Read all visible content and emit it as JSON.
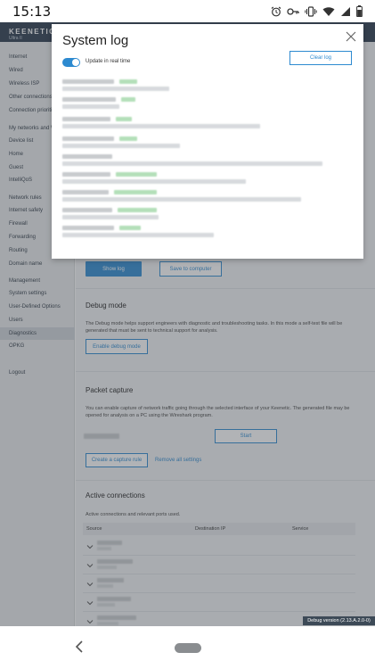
{
  "status_bar": {
    "time": "15:13",
    "icons": [
      "alarm-icon",
      "key-icon",
      "vibrate-icon",
      "wifi-icon",
      "signal-icon",
      "battery-icon"
    ]
  },
  "app": {
    "brand": "KEENETIC",
    "model": "Ultra II"
  },
  "sidebar": {
    "items": [
      {
        "label": "Internet"
      },
      {
        "label": "Wired"
      },
      {
        "label": "Wireless ISP"
      },
      {
        "label": "Other connections"
      },
      {
        "label": "Connection priorities"
      },
      {
        "label": "My networks and Wi-Fi"
      },
      {
        "label": "Device list"
      },
      {
        "label": "Home"
      },
      {
        "label": "Guest"
      },
      {
        "label": "IntelliQoS"
      },
      {
        "label": "Network rules"
      },
      {
        "label": "Internet safety"
      },
      {
        "label": "Firewall"
      },
      {
        "label": "Forwarding"
      },
      {
        "label": "Routing"
      },
      {
        "label": "Domain name"
      },
      {
        "label": "Management"
      },
      {
        "label": "System settings"
      },
      {
        "label": "User-Defined Options"
      },
      {
        "label": "Users"
      },
      {
        "label": "Diagnostics"
      },
      {
        "label": "OPKG"
      },
      {
        "label": "Logout"
      }
    ]
  },
  "main": {
    "log_buttons": {
      "show_log": "Show log",
      "save_to_computer": "Save to computer"
    },
    "debug": {
      "title": "Debug mode",
      "text": "The Debug mode helps support engineers with diagnostic and troubleshooting tasks. In this mode a self-test file will be generated that must be sent to technical support for analysis.",
      "button": "Enable debug mode"
    },
    "capture": {
      "title": "Packet capture",
      "text": "You can enable capture of network traffic going through the selected interface of your Keenetic. The generated file may be opened for analysis on a PC using the Wireshark program.",
      "start_button": "Start",
      "create_rule_button": "Create a capture rule",
      "remove_all_link": "Remove all settings"
    },
    "connections": {
      "title": "Active connections",
      "text": "Active connections and relevant ports used.",
      "columns": [
        "Source",
        "Destination IP",
        "Service"
      ]
    }
  },
  "modal": {
    "title": "System log",
    "toggle_label": "Update in real time",
    "toggle_on": true,
    "clear_button": "Clear log"
  },
  "debug_badge": "Debug version (2.13.A.2.0-0)",
  "colors": {
    "accent": "#2d8ad0",
    "header": "#2a3a4c",
    "sidebar": "#e8eaec"
  }
}
